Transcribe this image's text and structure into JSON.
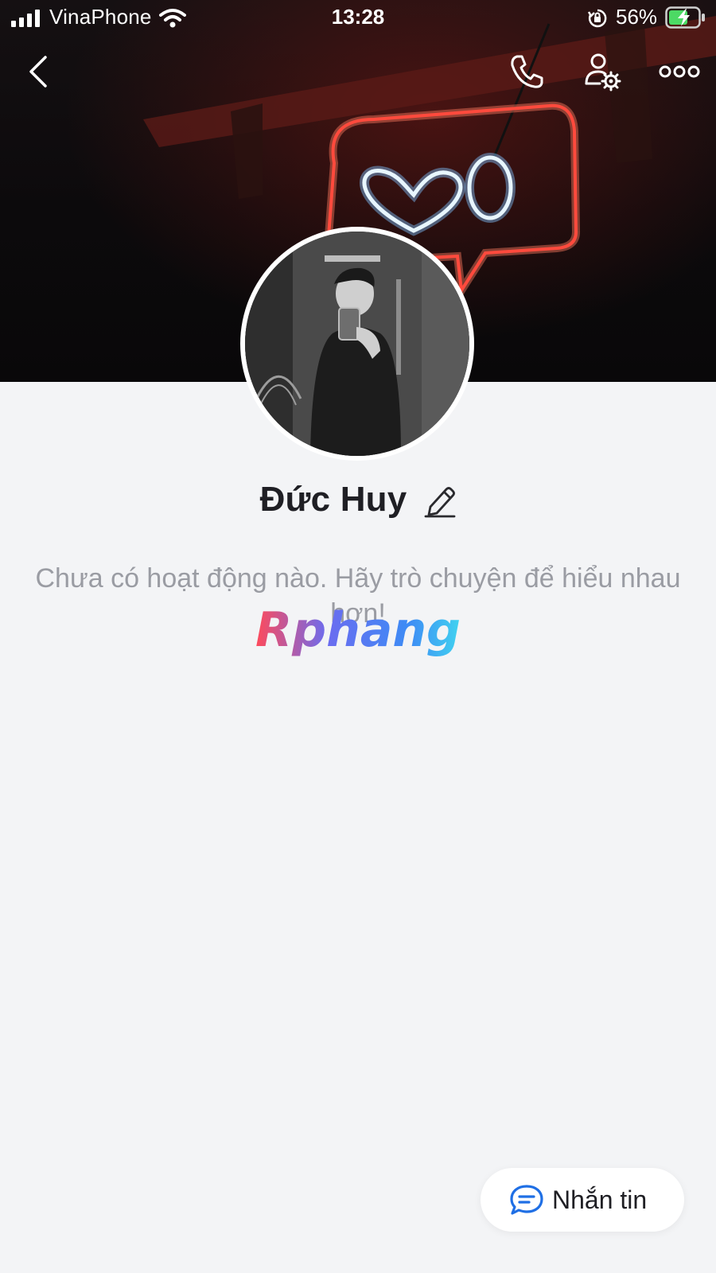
{
  "status_bar": {
    "carrier": "VinaPhone",
    "time": "13:28",
    "battery": "56%"
  },
  "nav": {
    "icons": [
      "back-arrow-icon",
      "phone-icon",
      "user-settings-icon",
      "more-options-icon"
    ]
  },
  "profile": {
    "name": "Đức Huy",
    "empty_activity": "Chưa có hoạt động nào. Hãy trò chuyện để hiểu nhau hơn!"
  },
  "watermark": {
    "text": "Rphang"
  },
  "actions": {
    "message_label": "Nhắn tin"
  },
  "colors": {
    "accent_blue": "#1f6fe5",
    "page_bg": "#f3f4f6",
    "neon_red": "#ff4a3d",
    "neon_blue": "#bfe6ff"
  }
}
